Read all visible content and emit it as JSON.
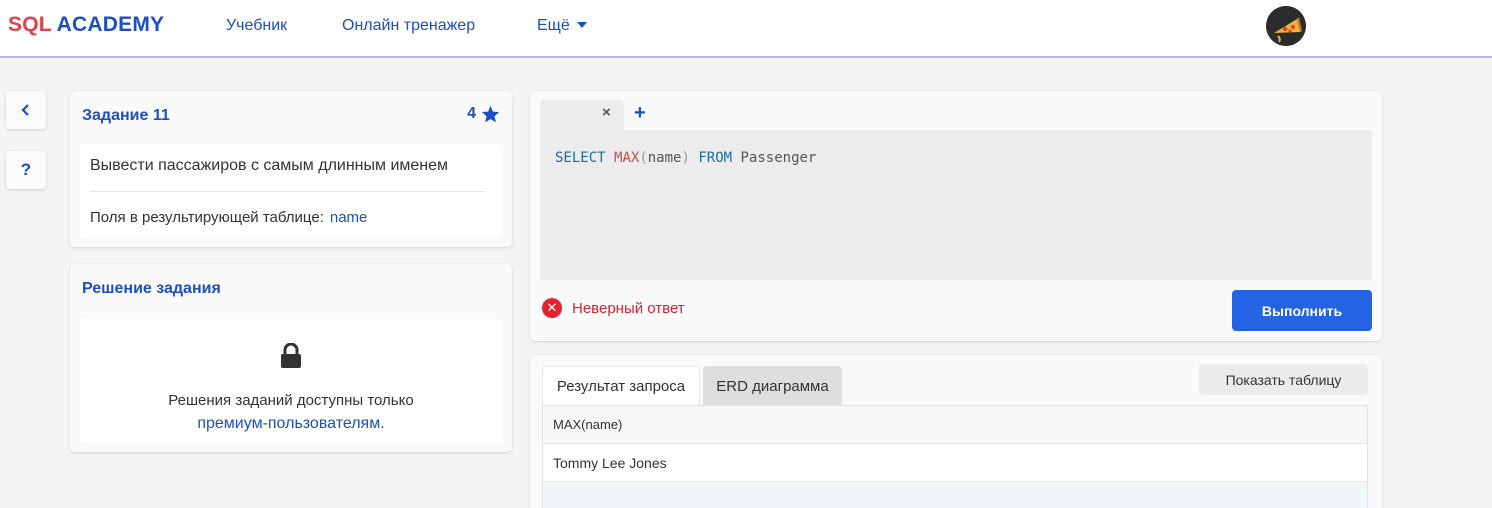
{
  "header": {
    "logo_part1": "SQL",
    "logo_part2": "ACADEMY",
    "nav": [
      {
        "label": "Учебник"
      },
      {
        "label": "Онлайн тренажер"
      },
      {
        "label": "Ещё"
      }
    ]
  },
  "sidebar": {
    "back_icon": "chevron-left",
    "help_label": "?"
  },
  "task": {
    "title": "Задание 11",
    "score": "4",
    "score_icon": "star",
    "description": "Вывести пассажиров с самым длинным именем",
    "fields_label": "Поля в результирующей таблице:",
    "fields_value": "name"
  },
  "solution": {
    "title": "Решение задания",
    "lock_icon": "lock",
    "locked_text": "Решения заданий доступны только",
    "premium_link": "премиум-пользователям."
  },
  "editor": {
    "tab_close": "×",
    "tab_add": "+",
    "code": {
      "select": "SELECT",
      "max": "MAX",
      "open": "(",
      "arg": "name",
      "close": ")",
      "from": "FROM",
      "table": "Passenger"
    },
    "status_text": "Неверный ответ",
    "status_color": "#d8232f",
    "run_label": "Выполнить",
    "run_color": "#2463e4"
  },
  "results": {
    "tabs": [
      {
        "label": "Результат запроса",
        "active": true
      },
      {
        "label": "ERD диаграмма",
        "active": false
      }
    ],
    "show_table_label": "Показать таблицу",
    "columns": [
      "MAX(name)"
    ],
    "rows": [
      [
        "Tommy Lee Jones"
      ]
    ]
  },
  "colors": {
    "accent": "#1d4fc4",
    "logo_red": "#e0414a"
  }
}
